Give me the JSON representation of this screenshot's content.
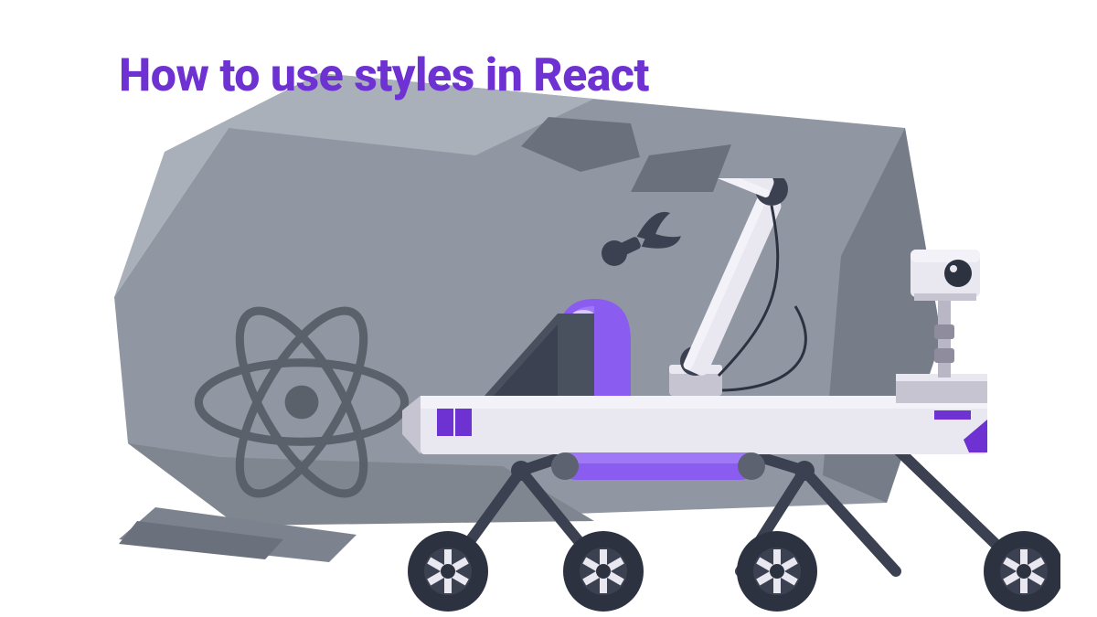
{
  "title": "How to use styles in React",
  "colors": {
    "accent": "#6d32d1",
    "accent_light": "#8a5cf0",
    "rock_light": "#a9afb9",
    "rock_mid": "#888f9b",
    "rock_dark": "#6b717c",
    "rover_light": "#e9e7f0",
    "rover_mid": "#c7c4d2",
    "rover_dark": "#3b4150",
    "wheel": "#2c3240"
  },
  "icons": {
    "rock": "rock-icon",
    "react": "react-logo-icon",
    "rover": "rover-icon",
    "camera": "camera-icon",
    "arm": "robot-arm-icon",
    "wheel": "wheel-icon"
  }
}
